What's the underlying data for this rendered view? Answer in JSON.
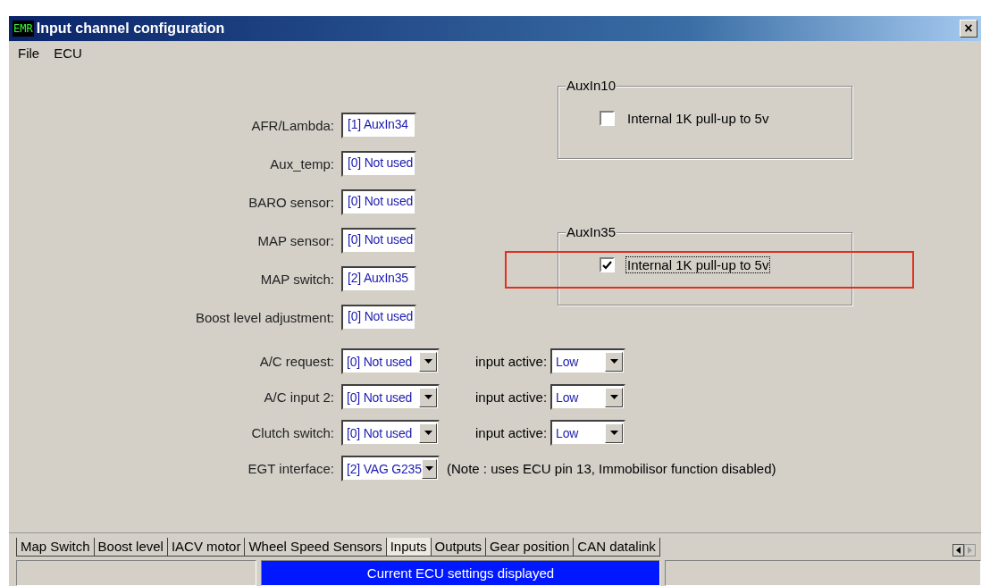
{
  "window": {
    "logo": "EMR",
    "title": "Input channel configuration",
    "close": "×"
  },
  "menu": [
    "File",
    "ECU"
  ],
  "fields": [
    {
      "label": "AFR/Lambda:",
      "value": "[1]  AuxIn34"
    },
    {
      "label": "Aux_temp:",
      "value": "[0]  Not used"
    },
    {
      "label": "BARO sensor:",
      "value": "[0]  Not used"
    },
    {
      "label": "MAP sensor:",
      "value": "[0]  Not used"
    },
    {
      "label": "MAP switch:",
      "value": "[2]  AuxIn35"
    },
    {
      "label": "Boost level adjustment:",
      "value": "[0]  Not used"
    }
  ],
  "groups": [
    {
      "title": "AuxIn10",
      "label": "Internal 1K pull-up to 5v",
      "checked": false,
      "focused": false,
      "highlighted": false
    },
    {
      "title": "AuxIn35",
      "label": "Internal 1K pull-up to 5v",
      "checked": true,
      "focused": true,
      "highlighted": true
    }
  ],
  "combos": [
    {
      "label": "A/C request:",
      "value": "[0]  Not used",
      "active_label": "input active:",
      "active_value": "Low"
    },
    {
      "label": "A/C input 2:",
      "value": "[0]  Not used",
      "active_label": "input active:",
      "active_value": "Low"
    },
    {
      "label": "Clutch switch:",
      "value": "[0]  Not used",
      "active_label": "input active:",
      "active_value": "Low"
    },
    {
      "label": "EGT interface:",
      "value": "[2] VAG G235",
      "note": "(Note : uses ECU pin 13, Immobilisor function disabled)"
    }
  ],
  "tabs": [
    {
      "label": "Map Switch",
      "selected": false
    },
    {
      "label": "Boost level",
      "selected": false
    },
    {
      "label": "IACV motor",
      "selected": false
    },
    {
      "label": "Wheel Speed Sensors",
      "selected": false
    },
    {
      "label": "Inputs",
      "selected": true
    },
    {
      "label": "Outputs",
      "selected": false
    },
    {
      "label": "Gear position",
      "selected": false
    },
    {
      "label": "CAN datalink",
      "selected": false
    }
  ],
  "status_bar": {
    "message": "Current ECU settings displayed"
  }
}
